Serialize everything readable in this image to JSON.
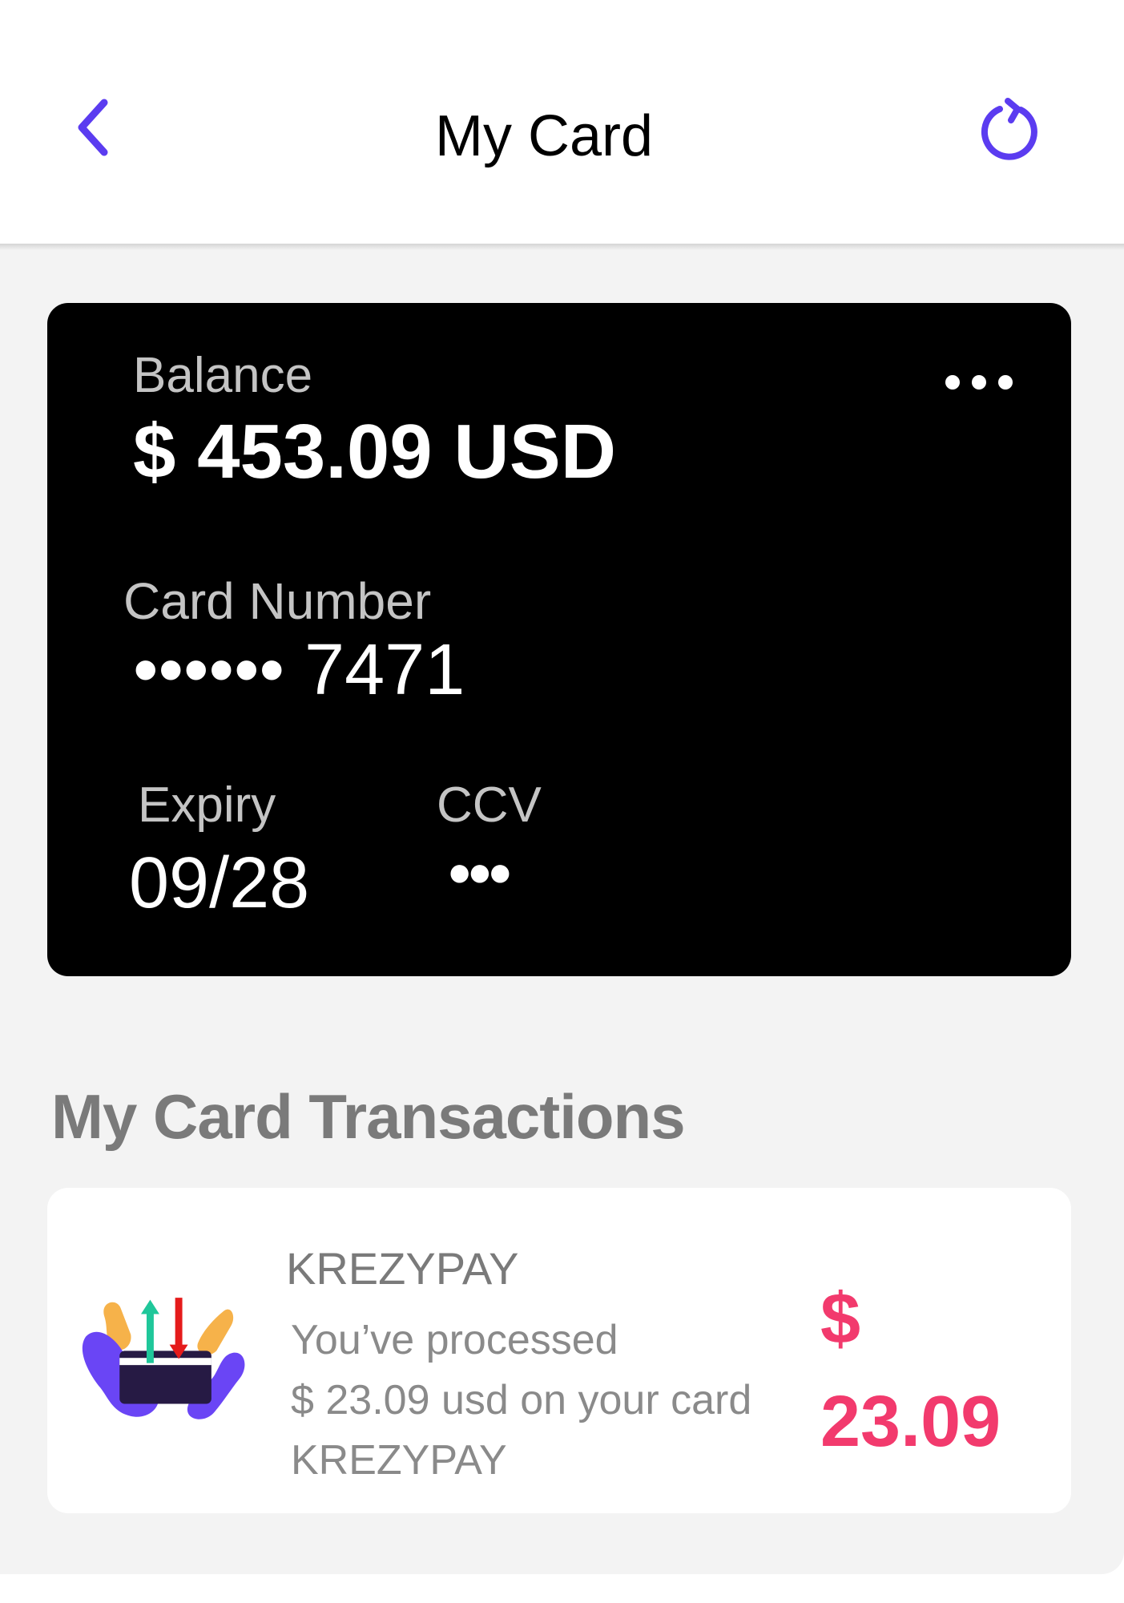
{
  "colors": {
    "accent": "#5b3cf0",
    "amount": "#f23a6d",
    "background": "#f3f3f3",
    "card": "#000000"
  },
  "header": {
    "title": "My Card",
    "back_icon": "chevron-left-icon",
    "refresh_icon": "refresh-icon"
  },
  "card": {
    "balance_label": "Balance",
    "balance_value": "$ 453.09 USD",
    "menu_icon": "more-horizontal-icon",
    "number_label": "Card Number",
    "number_value": "•••••• 7471",
    "expiry_label": "Expiry",
    "expiry_value": "09/28",
    "ccv_label": "CCV",
    "ccv_value": "•••"
  },
  "transactions": {
    "title": "My Card Transactions",
    "items": [
      {
        "icon": "card-transfer-icon",
        "merchant": "KREZYPAY",
        "description_lines": [
          "You’ve processed",
          "$ 23.09 usd on your card",
          "KREZYPAY"
        ],
        "amount": "$ 23.09"
      }
    ]
  }
}
